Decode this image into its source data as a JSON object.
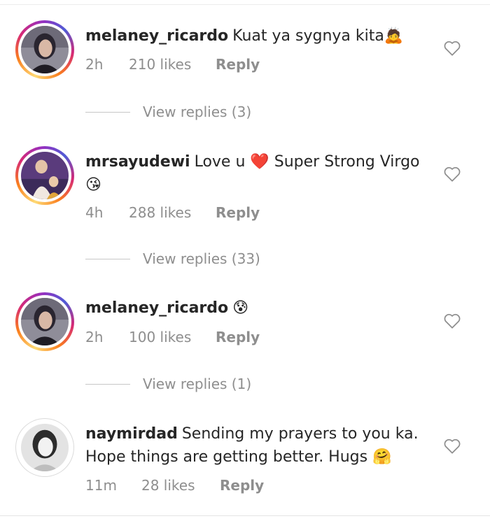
{
  "comments": [
    {
      "username": "melaney_ricardo",
      "text": "Kuat ya sygnya kita🙇",
      "time": "2h",
      "likes": "210 likes",
      "reply_label": "Reply",
      "view_replies": "View replies (3)",
      "avatar_colors": [
        "#3e3a44",
        "#8b8896"
      ]
    },
    {
      "username": "mrsayudewi",
      "text": "Love u ❤️ Super Strong Virgo 😘",
      "time": "4h",
      "likes": "288 likes",
      "reply_label": "Reply",
      "view_replies": "View replies (33)",
      "avatar_colors": [
        "#6b3f8e",
        "#d7b38c"
      ]
    },
    {
      "username": "melaney_ricardo",
      "text": "😰",
      "time": "2h",
      "likes": "100 likes",
      "reply_label": "Reply",
      "view_replies": "View replies (1)",
      "avatar_colors": [
        "#3e3a44",
        "#8b8896"
      ]
    },
    {
      "username": "naymirdad",
      "text": "Sending my prayers to you ka. Hope things are getting better. Hugs 🤗",
      "time": "11m",
      "likes": "28 likes",
      "reply_label": "Reply",
      "avatar_colors": [
        "#2b2b2b",
        "#dcdcdc"
      ]
    }
  ],
  "icons": {
    "like": "heart-outline-icon"
  },
  "colors": {
    "text": "#262626",
    "muted": "#8e8e8e",
    "story_ring": "#d62976"
  }
}
